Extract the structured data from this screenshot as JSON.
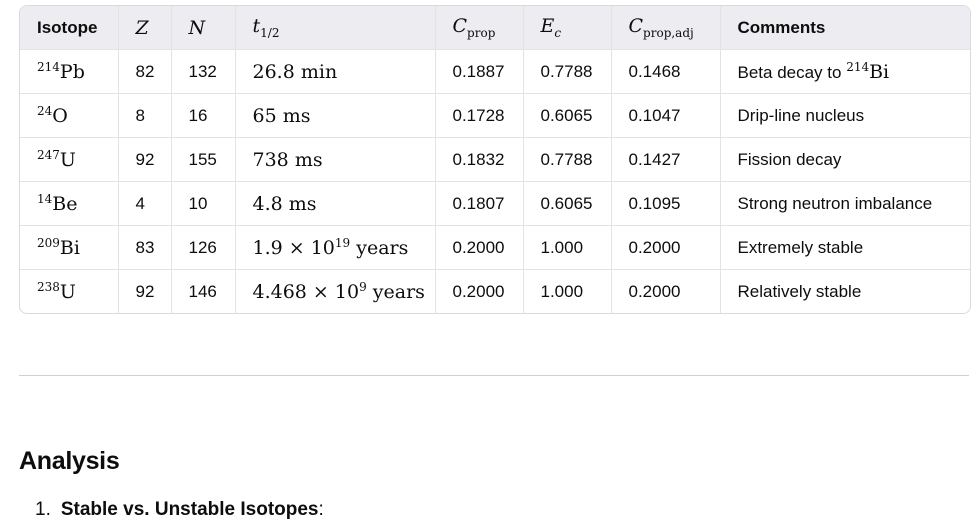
{
  "table": {
    "headers": {
      "isotope": "Isotope",
      "z": "Z",
      "n": "N",
      "t_base": "t",
      "t_sub": "1/2",
      "cprop_base": "C",
      "cprop_sub": "prop",
      "ec_base": "E",
      "ec_sub": "c",
      "cadj_base": "C",
      "cadj_sub": "prop,adj",
      "comments": "Comments"
    },
    "rows": [
      {
        "mass": "214",
        "symbol": "Pb",
        "z": "82",
        "n": "132",
        "half_life_value": "26.8",
        "half_life_exp": "",
        "half_life_unit": "min",
        "c_prop": "0.1887",
        "e_c": "0.7788",
        "c_prop_adj": "0.1468",
        "comment": "Beta decay to ",
        "comment_mass": "214",
        "comment_symbol": "Bi"
      },
      {
        "mass": "24",
        "symbol": "O",
        "z": "8",
        "n": "16",
        "half_life_value": "65",
        "half_life_exp": "",
        "half_life_unit": "ms",
        "c_prop": "0.1728",
        "e_c": "0.6065",
        "c_prop_adj": "0.1047",
        "comment": "Drip-line nucleus",
        "comment_mass": "",
        "comment_symbol": ""
      },
      {
        "mass": "247",
        "symbol": "U",
        "z": "92",
        "n": "155",
        "half_life_value": "738",
        "half_life_exp": "",
        "half_life_unit": "ms",
        "c_prop": "0.1832",
        "e_c": "0.7788",
        "c_prop_adj": "0.1427",
        "comment": "Fission decay",
        "comment_mass": "",
        "comment_symbol": ""
      },
      {
        "mass": "14",
        "symbol": "Be",
        "z": "4",
        "n": "10",
        "half_life_value": "4.8",
        "half_life_exp": "",
        "half_life_unit": "ms",
        "c_prop": "0.1807",
        "e_c": "0.6065",
        "c_prop_adj": "0.1095",
        "comment": "Strong neutron imbalance",
        "comment_mass": "",
        "comment_symbol": ""
      },
      {
        "mass": "209",
        "symbol": "Bi",
        "z": "83",
        "n": "126",
        "half_life_value": "1.9 × 10",
        "half_life_exp": "19",
        "half_life_unit": "years",
        "c_prop": "0.2000",
        "e_c": "1.000",
        "c_prop_adj": "0.2000",
        "comment": "Extremely stable",
        "comment_mass": "",
        "comment_symbol": ""
      },
      {
        "mass": "238",
        "symbol": "U",
        "z": "92",
        "n": "146",
        "half_life_value": "4.468 × 10",
        "half_life_exp": "9",
        "half_life_unit": "years",
        "c_prop": "0.2000",
        "e_c": "1.000",
        "c_prop_adj": "0.2000",
        "comment": "Relatively stable",
        "comment_mass": "",
        "comment_symbol": ""
      }
    ]
  },
  "analysis": {
    "heading": "Analysis",
    "item_number": "1.",
    "item_title": "Stable vs. Unstable Isotopes",
    "item_suffix": ":"
  }
}
